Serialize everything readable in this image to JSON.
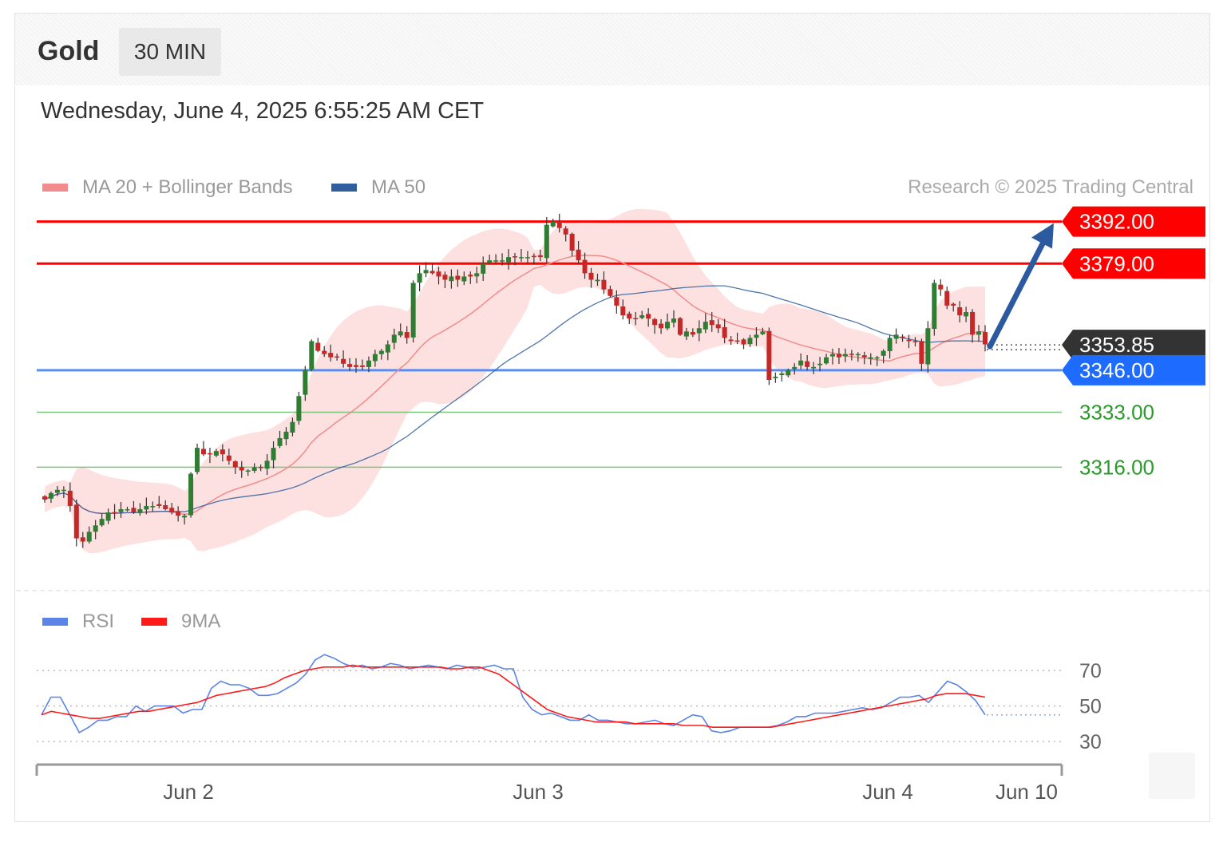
{
  "header": {
    "instrument": "Gold",
    "timeframe": "30 MIN",
    "datetime": "Wednesday, June 4, 2025 6:55:25 AM CET"
  },
  "legend": {
    "main": [
      {
        "label": "MA 20 + Bollinger Bands",
        "color": "#f28b8b"
      },
      {
        "label": "MA 50",
        "color": "#2f5f9e"
      }
    ],
    "rsi": [
      {
        "label": "RSI",
        "color": "#5b84e6"
      },
      {
        "label": "9MA",
        "color": "#ff1a1a"
      }
    ],
    "copyright": "Research © 2025 Trading Central"
  },
  "chart_data": [
    {
      "type": "candlestick",
      "title": "Gold",
      "ylim": [
        3284,
        3394
      ],
      "levels": [
        {
          "value": 3392.0,
          "label": "3392.00",
          "kind": "resistance",
          "color": "#ff0000"
        },
        {
          "value": 3379.0,
          "label": "3379.00",
          "kind": "resistance",
          "color": "#ff0000"
        },
        {
          "value": 3353.85,
          "label": "3353.85",
          "kind": "last",
          "color": "#333333"
        },
        {
          "value": 3346.0,
          "label": "3346.00",
          "kind": "pivot",
          "color": "#1e6cff"
        },
        {
          "value": 3333.0,
          "label": "3333.00",
          "kind": "support",
          "color": "#2a9a2a"
        },
        {
          "value": 3316.0,
          "label": "3316.00",
          "kind": "support",
          "color": "#2a9a2a"
        }
      ],
      "x_ticks": [
        "Jun 2",
        "Jun 3",
        "Jun 4",
        "Jun 10"
      ],
      "projection": {
        "from": 3353.85,
        "to": 3392.0,
        "direction": "up"
      },
      "close": [
        3306,
        3308,
        3309,
        3309,
        3304,
        3294,
        3293,
        3296,
        3298,
        3300,
        3302,
        3302,
        3303,
        3303,
        3302,
        3303,
        3304,
        3304,
        3304,
        3303,
        3302,
        3301,
        3301,
        3314,
        3322,
        3320,
        3320,
        3321,
        3320,
        3318,
        3316,
        3315,
        3315,
        3316,
        3316,
        3318,
        3322,
        3325,
        3327,
        3330,
        3338,
        3346,
        3355,
        3352,
        3351,
        3350,
        3350,
        3348,
        3347,
        3347,
        3347,
        3349,
        3351,
        3352,
        3354,
        3357,
        3358,
        3356,
        3373,
        3376,
        3377,
        3376,
        3375,
        3374,
        3375,
        3374,
        3375,
        3375,
        3376,
        3379,
        3380,
        3380,
        3380,
        3381,
        3381,
        3381,
        3381,
        3381,
        3381,
        3391,
        3392,
        3390,
        3388,
        3383,
        3380,
        3376,
        3374,
        3374,
        3371,
        3369,
        3366,
        3363,
        3362,
        3362,
        3363,
        3362,
        3360,
        3359,
        3361,
        3362,
        3357,
        3358,
        3357,
        3359,
        3361,
        3360,
        3359,
        3356,
        3355,
        3355,
        3354,
        3356,
        3357,
        3358,
        3343,
        3344,
        3345,
        3346,
        3347,
        3349,
        3347,
        3347,
        3348,
        3350,
        3351,
        3350,
        3351,
        3351,
        3351,
        3350,
        3350,
        3350,
        3352,
        3356,
        3357,
        3356,
        3355,
        3355,
        3348,
        3359,
        3373,
        3371,
        3366,
        3366,
        3363,
        3364,
        3357,
        3358,
        3354
      ]
    },
    {
      "type": "line",
      "title": "RSI",
      "ylim": [
        18,
        82
      ],
      "reference_lines": [
        70,
        50,
        30
      ],
      "y_ticks": [
        "70",
        "50",
        "30"
      ],
      "series": [
        {
          "name": "RSI",
          "color": "#5b84e6",
          "values": [
            45,
            55,
            55,
            45,
            35,
            38,
            42,
            42,
            44,
            44,
            50,
            47,
            50,
            50,
            50,
            46,
            48,
            48,
            60,
            64,
            62,
            62,
            60,
            56,
            56,
            57,
            60,
            63,
            68,
            76,
            79,
            77,
            74,
            72,
            73,
            71,
            72,
            74,
            73,
            71,
            72,
            73,
            72,
            71,
            73,
            72,
            71,
            72,
            73,
            71,
            71,
            55,
            48,
            45,
            46,
            44,
            42,
            42,
            45,
            42,
            42,
            41,
            40,
            40,
            41,
            42,
            40,
            39,
            42,
            45,
            44,
            36,
            35,
            36,
            38,
            38,
            38,
            38,
            39,
            41,
            44,
            44,
            46,
            46,
            46,
            47,
            48,
            49,
            48,
            49,
            52,
            55,
            55,
            56,
            52,
            58,
            64,
            62,
            58,
            53,
            45
          ]
        },
        {
          "name": "9MA",
          "color": "#ff1a1a",
          "values": [
            45,
            47,
            46,
            45,
            44,
            43,
            43,
            44,
            45,
            46,
            47,
            47,
            48,
            49,
            50,
            51,
            52,
            54,
            56,
            57,
            58,
            59,
            60,
            61,
            63,
            66,
            68,
            70,
            71,
            72,
            72,
            72,
            73,
            72,
            72,
            72,
            72,
            72,
            72,
            72,
            72,
            72,
            71,
            71,
            72,
            72,
            70,
            68,
            64,
            60,
            56,
            52,
            48,
            46,
            44,
            43,
            42,
            41,
            41,
            41,
            41,
            40,
            40,
            40,
            40,
            40,
            39,
            39,
            39,
            38,
            38,
            38,
            38,
            38,
            38,
            38,
            39,
            40,
            41,
            42,
            43,
            44,
            45,
            46,
            47,
            48,
            49,
            50,
            51,
            52,
            53,
            54,
            56,
            57,
            57,
            57,
            56,
            55
          ]
        }
      ]
    }
  ]
}
